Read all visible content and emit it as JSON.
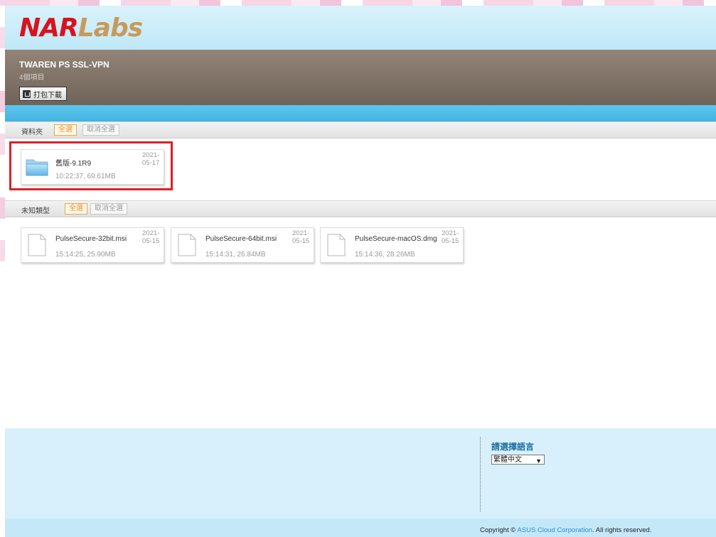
{
  "header": {
    "logo_primary": "NAR",
    "logo_secondary": "Labs",
    "title": "TWAREN PS SSL-VPN",
    "item_count": "4個項目",
    "download_button": "打包下載"
  },
  "folders_section": {
    "label": "資料夾",
    "select_all": "全選",
    "deselect_all": "取消全選",
    "items": [
      {
        "name": "舊版-9.1R9",
        "meta": "10:22:37,  69.61MB",
        "date_line1": "2021-",
        "date_line2": "05-17"
      }
    ]
  },
  "files_section": {
    "label": "未知類型",
    "select_all": "全選",
    "deselect_all": "取消全選",
    "items": [
      {
        "name": "PulseSecure-32bit.msi",
        "meta": "15:14:25,  25.90MB",
        "date_line1": "2021-",
        "date_line2": "05-15"
      },
      {
        "name": "PulseSecure-64bit.msi",
        "meta": "15:14:31,  26.84MB",
        "date_line1": "2021-",
        "date_line2": "05-15"
      },
      {
        "name": "PulseSecure-macOS.dmg",
        "meta": "15:14:36,  28.26MB",
        "date_line1": "2021-",
        "date_line2": "05-15"
      }
    ]
  },
  "footer": {
    "language_title": "請選擇語言",
    "language_selected": "繁體中文",
    "copyright_prefix": "Copyright © ",
    "copyright_link": "ASUS Cloud Corporation",
    "copyright_suffix": ". All rights reserved."
  },
  "colors": {
    "highlight_border": "#e01f26",
    "select_all_accent": "#ef8f1a",
    "logo_red": "#d7131f",
    "logo_gold": "#c79a5a",
    "link_blue": "#2a8fd8"
  }
}
